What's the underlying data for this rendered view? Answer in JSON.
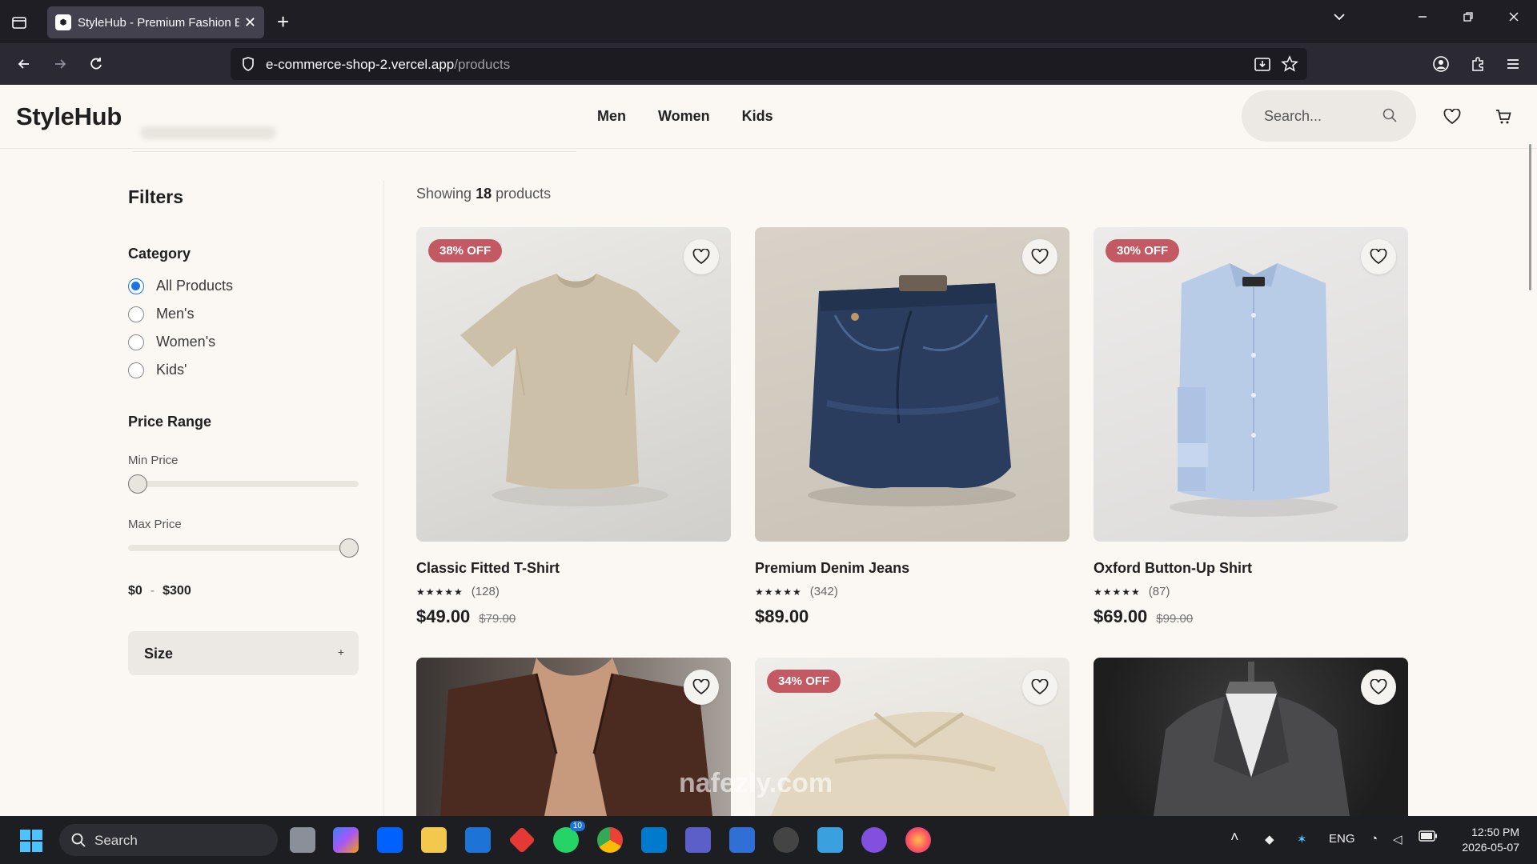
{
  "browser": {
    "tab_title": "StyleHub - Premium Fashion E-c",
    "url_host": "e-commerce-shop-2.vercel.app",
    "url_path": "/products"
  },
  "site": {
    "logo": "StyleHub",
    "nav": [
      "Men",
      "Women",
      "Kids"
    ],
    "search_placeholder": "Search..."
  },
  "filters": {
    "title": "Filters",
    "category_title": "Category",
    "categories": [
      {
        "label": "All Products",
        "selected": true
      },
      {
        "label": "Men's",
        "selected": false
      },
      {
        "label": "Women's",
        "selected": false
      },
      {
        "label": "Kids'",
        "selected": false
      }
    ],
    "price_title": "Price Range",
    "min_label": "Min Price",
    "max_label": "Max Price",
    "range_min": "$0",
    "range_sep": "-",
    "range_max": "$300",
    "min_value": 0,
    "max_value": 300,
    "size_label": "Size",
    "size_toggle": "+"
  },
  "results": {
    "prefix": "Showing",
    "count": "18",
    "suffix": "products"
  },
  "products": [
    {
      "name": "Classic Fitted T-Shirt",
      "badge": "38% OFF",
      "stars": "★★★★★",
      "reviews": "(128)",
      "price": "$49.00",
      "old_price": "$79.00"
    },
    {
      "name": "Premium Denim Jeans",
      "badge": "",
      "stars": "★★★★★",
      "reviews": "(342)",
      "price": "$89.00",
      "old_price": ""
    },
    {
      "name": "Oxford Button-Up Shirt",
      "badge": "30% OFF",
      "stars": "★★★★★",
      "reviews": "(87)",
      "price": "$69.00",
      "old_price": "$99.00"
    },
    {
      "name": "",
      "badge": "",
      "stars": "",
      "reviews": "",
      "price": "",
      "old_price": ""
    },
    {
      "name": "",
      "badge": "34% OFF",
      "stars": "",
      "reviews": "",
      "price": "",
      "old_price": ""
    },
    {
      "name": "",
      "badge": "",
      "stars": "",
      "reviews": "",
      "price": "",
      "old_price": ""
    }
  ],
  "taskbar": {
    "search": "Search",
    "lang": "ENG",
    "time": "12:50 PM",
    "date": "2026-05-07",
    "badge_count": "10"
  },
  "watermark": "nafezly.com",
  "colors": {
    "accent": "#1a73e8",
    "badge": "#c35a63",
    "page_bg": "#fbf8f4"
  }
}
